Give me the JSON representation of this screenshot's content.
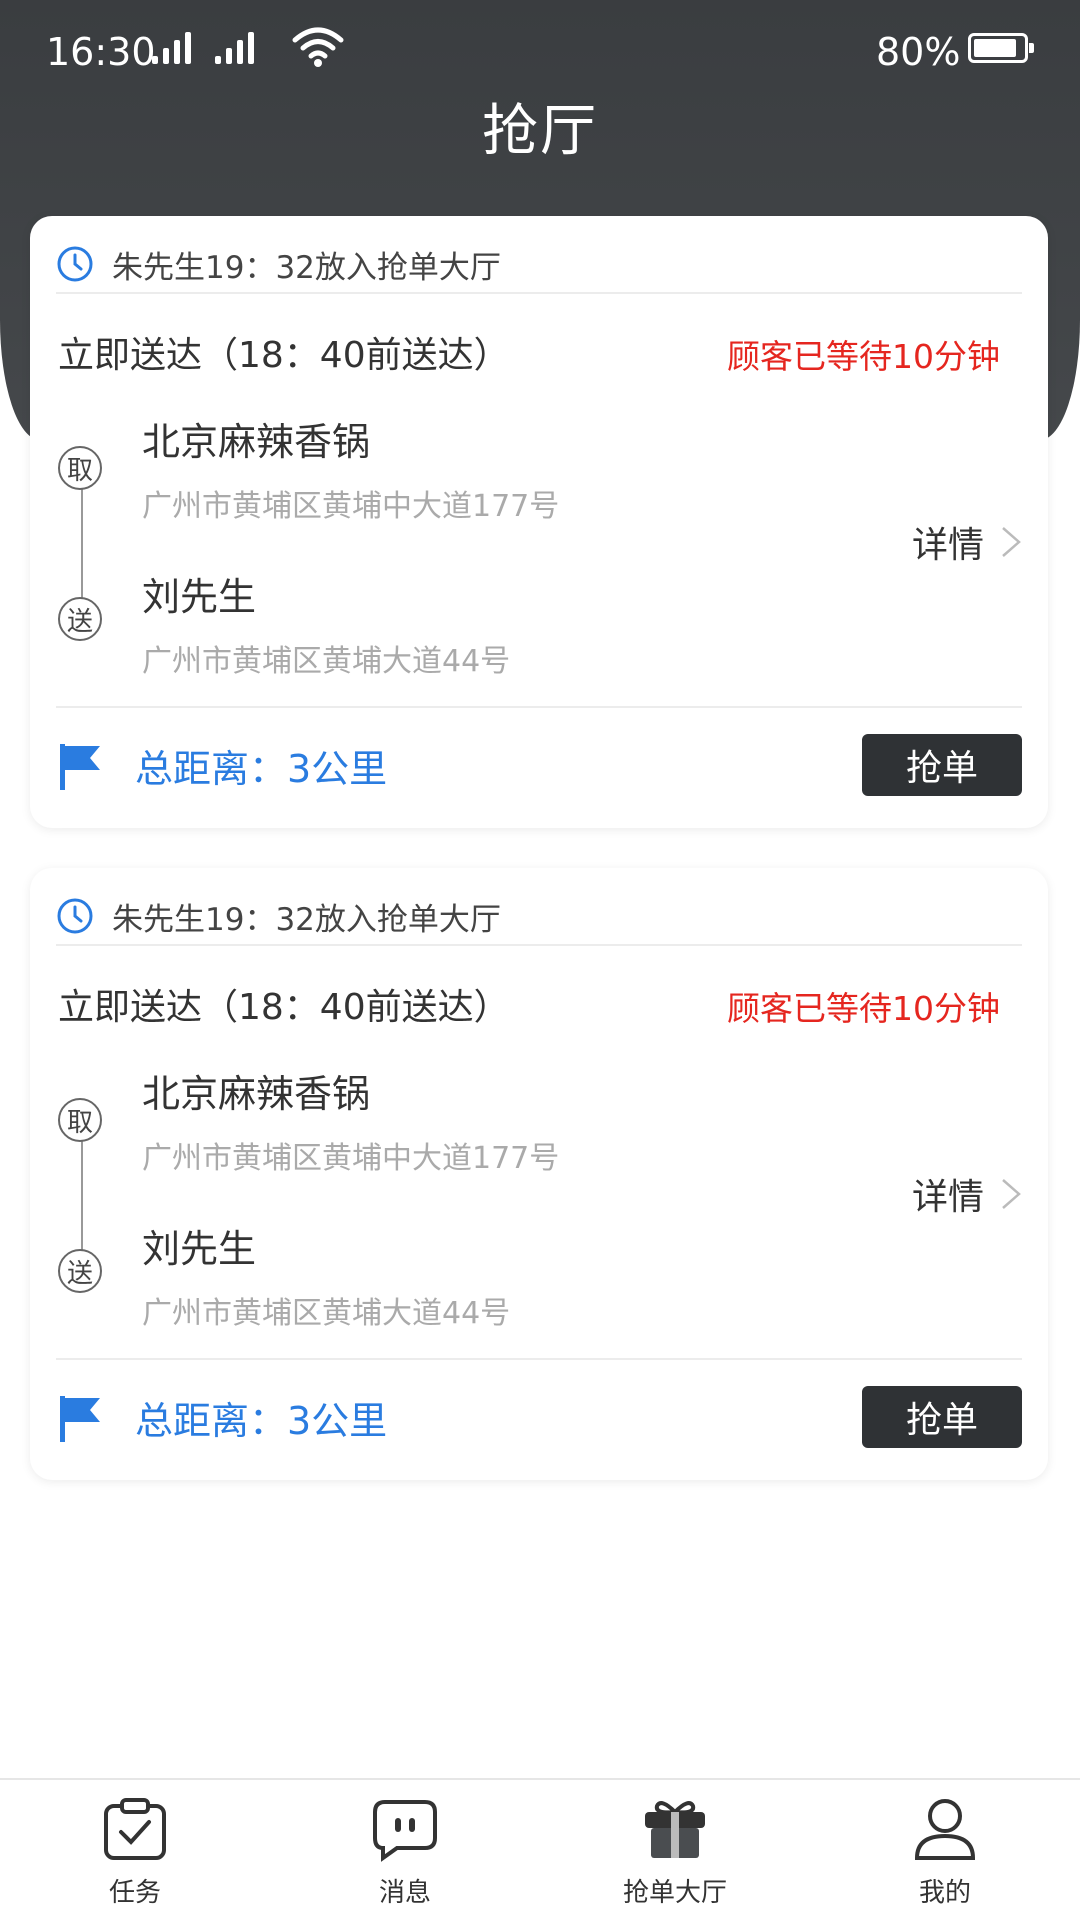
{
  "status_bar": {
    "time": "16:30",
    "battery": "80%"
  },
  "header": {
    "title": "抢厅"
  },
  "orders": [
    {
      "placed": "朱先生19：32放入抢单大厅",
      "deliver": "立即送达（18：40前送达）",
      "wait": "顾客已等待10分钟",
      "pickup_marker": "取",
      "pickup_name": "北京麻辣香锅",
      "pickup_address": "广州市黄埔区黄埔中大道177号",
      "dropoff_marker": "送",
      "dropoff_name": "刘先生",
      "dropoff_address": "广州市黄埔区黄埔大道44号",
      "detail_label": "详情",
      "distance": "总距离：3公里",
      "grab_label": "抢单"
    },
    {
      "placed": "朱先生19：32放入抢单大厅",
      "deliver": "立即送达（18：40前送达）",
      "wait": "顾客已等待10分钟",
      "pickup_marker": "取",
      "pickup_name": "北京麻辣香锅",
      "pickup_address": "广州市黄埔区黄埔中大道177号",
      "dropoff_marker": "送",
      "dropoff_name": "刘先生",
      "dropoff_address": "广州市黄埔区黄埔大道44号",
      "detail_label": "详情",
      "distance": "总距离：3公里",
      "grab_label": "抢单"
    }
  ],
  "tabs": [
    {
      "label": "任务",
      "icon": "clipboard-check-icon"
    },
    {
      "label": "消息",
      "icon": "chat-bubble-icon"
    },
    {
      "label": "抢单大厅",
      "icon": "gift-box-icon",
      "active": true
    },
    {
      "label": "我的",
      "icon": "user-icon"
    }
  ],
  "colors": {
    "header": "#3a3d40",
    "accent_blue": "#2a7ce0",
    "alert_red": "#e5261f",
    "button_dark": "#2f3235"
  }
}
